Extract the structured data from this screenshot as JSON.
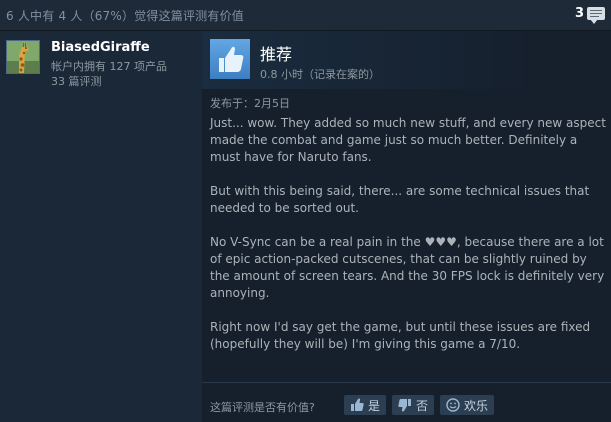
{
  "header": {
    "helpful_text": "6 人中有 4 人（67%）觉得这篇评测有价值",
    "comment_count": "3",
    "comment_icon": "speech-bubble-icon"
  },
  "reviewer": {
    "name": "BiasedGiraffe",
    "products_owned": "帐户内拥有 127 项产品",
    "reviews_count": "33 篇评测",
    "avatar_icon": "giraffe-avatar"
  },
  "review": {
    "recommendation": "推荐",
    "hours": "0.8 小时（记录在案的）",
    "posted": "发布于：2月5日",
    "paragraphs": [
      "Just... wow. They added so much new stuff, and every new aspect made the combat and game just so much better. Definitely a must have for Naruto fans.",
      "But with this being said, there... are some technical issues that needed to be sorted out.",
      "No V-Sync can be a real pain in the ♥♥♥, because there are a lot of epic action-packed cutscenes, that can be slightly ruined by the amount of screen tears. And the 30 FPS lock is definitely very annoying.",
      "Right now I'd say get the game, but until these issues are fixed (hopefully they will be) I'm giving this game a 7/10."
    ]
  },
  "footer": {
    "question": "这篇评测是否有价值?",
    "yes_label": "是",
    "no_label": "否",
    "funny_label": "欢乐"
  },
  "colors": {
    "background": "#1b2838",
    "panel": "#16202d",
    "thumb_blue": "#4b8fd6",
    "button": "#2b3e52"
  }
}
